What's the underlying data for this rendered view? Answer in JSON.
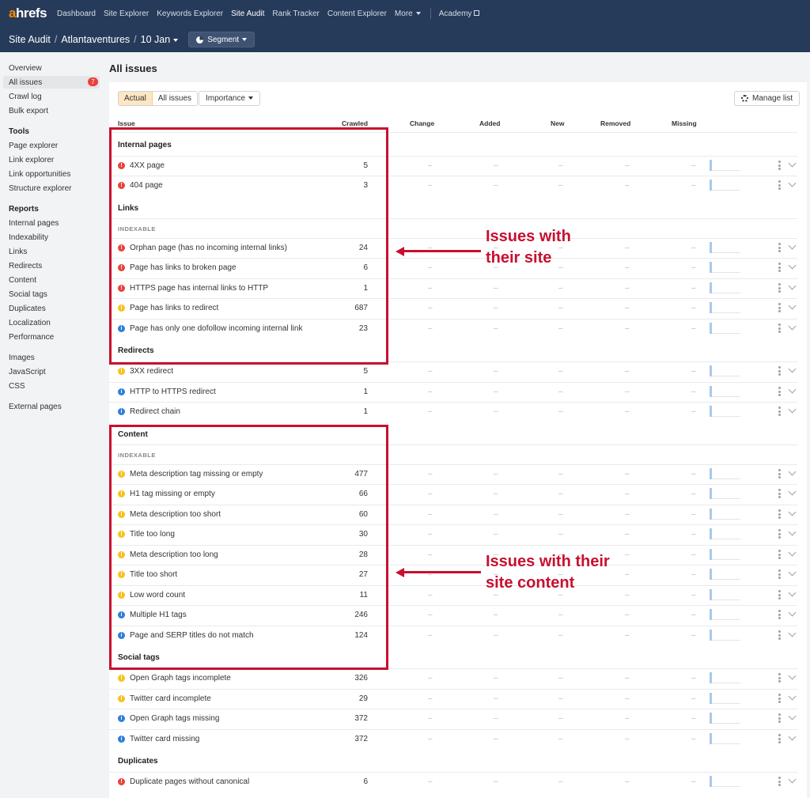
{
  "nav": {
    "logo_a": "a",
    "logo_rest": "hrefs",
    "links": [
      "Dashboard",
      "Site Explorer",
      "Keywords Explorer",
      "Site Audit",
      "Rank Tracker",
      "Content Explorer",
      "More"
    ],
    "academy": "Academy"
  },
  "subheader": {
    "crumb1": "Site Audit",
    "crumb2": "Atlantaventures",
    "crumb3": "10 Jan",
    "sep": "/",
    "segment": "Segment"
  },
  "sidebar": {
    "badge": "7",
    "top": [
      "Overview",
      "All issues",
      "Crawl log",
      "Bulk export"
    ],
    "tools_head": "Tools",
    "tools": [
      "Page explorer",
      "Link explorer",
      "Link opportunities",
      "Structure explorer"
    ],
    "reports_head": "Reports",
    "reports": [
      "Internal pages",
      "Indexability",
      "Links",
      "Redirects",
      "Content",
      "Social tags",
      "Duplicates",
      "Localization",
      "Performance"
    ],
    "extra": [
      "Images",
      "JavaScript",
      "CSS"
    ],
    "external": "External pages"
  },
  "main": {
    "title": "All issues",
    "toolbar": {
      "actual": "Actual",
      "all_issues": "All issues",
      "importance": "Importance",
      "manage_list": "Manage list"
    },
    "columns": [
      "Issue",
      "Crawled",
      "Change",
      "Added",
      "New",
      "Removed",
      "Missing"
    ],
    "dash": "–",
    "sections": {
      "internal_pages": "Internal pages",
      "links": "Links",
      "indexable": "INDEXABLE",
      "redirects": "Redirects",
      "content": "Content",
      "content_indexable": "INDEXABLE",
      "social_tags": "Social tags",
      "duplicates": "Duplicates"
    },
    "rows": [
      {
        "sev": "error",
        "name": "4XX page",
        "crawled": "5"
      },
      {
        "sev": "error",
        "name": "404 page",
        "crawled": "3"
      },
      {
        "sev": "error",
        "name": "Orphan page (has no incoming internal links)",
        "crawled": "24"
      },
      {
        "sev": "error",
        "name": "Page has links to broken page",
        "crawled": "6"
      },
      {
        "sev": "error",
        "name": "HTTPS page has internal links to HTTP",
        "crawled": "1"
      },
      {
        "sev": "warning",
        "name": "Page has links to redirect",
        "crawled": "687"
      },
      {
        "sev": "notice",
        "name": "Page has only one dofollow incoming internal link",
        "crawled": "23"
      },
      {
        "sev": "warning",
        "name": "3XX redirect",
        "crawled": "5"
      },
      {
        "sev": "notice",
        "name": "HTTP to HTTPS redirect",
        "crawled": "1"
      },
      {
        "sev": "notice",
        "name": "Redirect chain",
        "crawled": "1"
      },
      {
        "sev": "warning",
        "name": "Meta description tag missing or empty",
        "crawled": "477"
      },
      {
        "sev": "warning",
        "name": "H1 tag missing or empty",
        "crawled": "66"
      },
      {
        "sev": "warning",
        "name": "Meta description too short",
        "crawled": "60"
      },
      {
        "sev": "warning",
        "name": "Title too long",
        "crawled": "30"
      },
      {
        "sev": "warning",
        "name": "Meta description too long",
        "crawled": "28"
      },
      {
        "sev": "warning",
        "name": "Title too short",
        "crawled": "27"
      },
      {
        "sev": "warning",
        "name": "Low word count",
        "crawled": "11"
      },
      {
        "sev": "notice",
        "name": "Multiple H1 tags",
        "crawled": "246"
      },
      {
        "sev": "notice",
        "name": "Page and SERP titles do not match",
        "crawled": "124"
      },
      {
        "sev": "warning",
        "name": "Open Graph tags incomplete",
        "crawled": "326"
      },
      {
        "sev": "warning",
        "name": "Twitter card incomplete",
        "crawled": "29"
      },
      {
        "sev": "notice",
        "name": "Open Graph tags missing",
        "crawled": "372"
      },
      {
        "sev": "notice",
        "name": "Twitter card missing",
        "crawled": "372"
      },
      {
        "sev": "error",
        "name": "Duplicate pages without canonical",
        "crawled": "6"
      }
    ]
  },
  "annotations": {
    "site": "Issues with\ntheir site",
    "content": "Issues with their\nsite content"
  },
  "colors": {
    "error": "#e8423c",
    "warning": "#f6c21d",
    "notice": "#2f7ed8",
    "annotation": "#c8102e",
    "nav_bg": "#263b5a"
  }
}
